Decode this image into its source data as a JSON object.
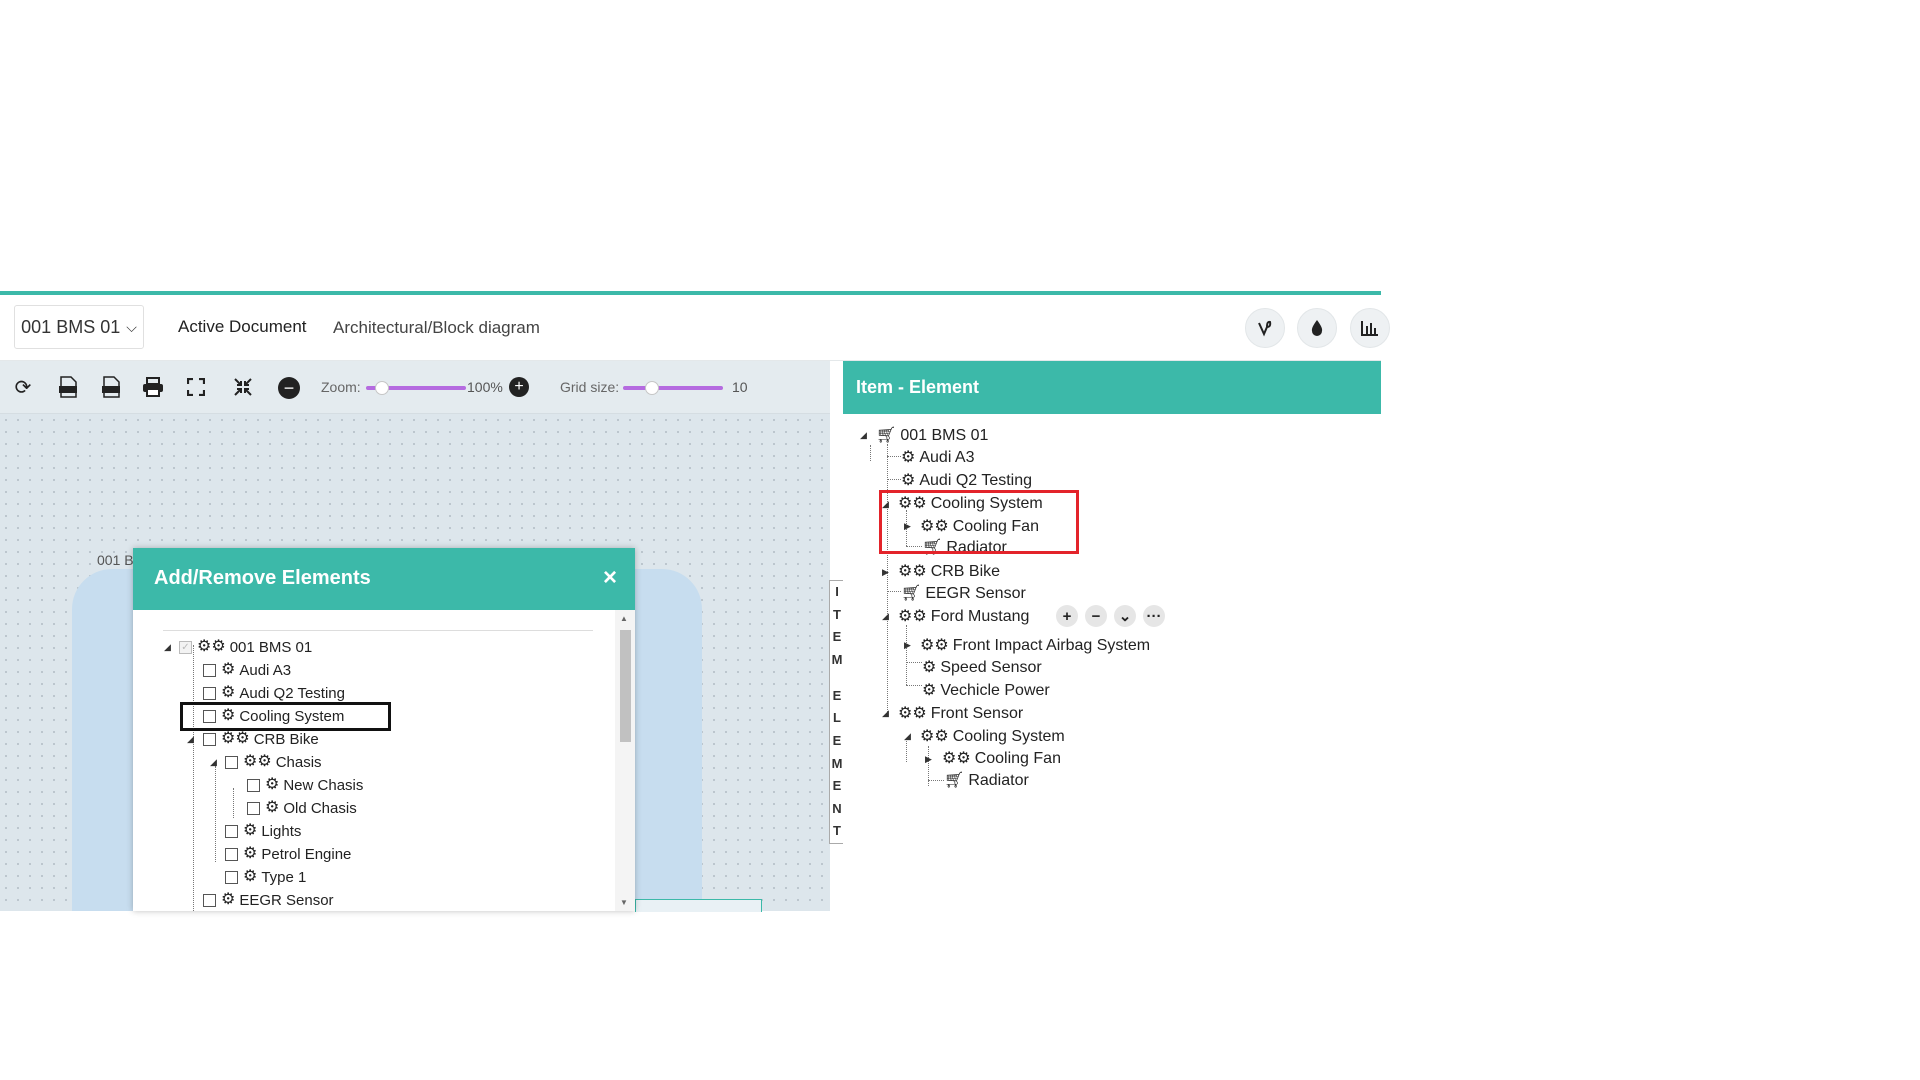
{
  "header": {
    "document_selector": "001 BMS 01",
    "active_document_label": "Active Document",
    "active_document_value": "Architectural/Block diagram",
    "icons": [
      "vine-icon",
      "drop-icon",
      "chart-icon"
    ]
  },
  "toolbar": {
    "svg_label": "SVG",
    "png_label": "PNG",
    "zoom_label": "Zoom:",
    "zoom_value": "100%",
    "grid_label": "Grid size:",
    "grid_value": "10",
    "zoom_fraction": 0.09,
    "grid_fraction": 0.22
  },
  "canvas": {
    "block_label": "001 B"
  },
  "side_tab": {
    "letters": [
      "I",
      "T",
      "E",
      "M",
      "",
      "E",
      "L",
      "E",
      "M",
      "E",
      "N",
      "T"
    ]
  },
  "item_panel": {
    "title": "Item - Element",
    "nodes": {
      "root": "001 BMS 01",
      "audi_a3": "Audi A3",
      "audi_q2": "Audi Q2 Testing",
      "cooling_system": "Cooling System",
      "cooling_fan": "Cooling Fan",
      "radiator": "Radiator",
      "crb_bike": "CRB Bike",
      "eegr_sensor": "EEGR Sensor",
      "ford_mustang": "Ford Mustang",
      "front_impact": "Front Impact Airbag System",
      "speed_sensor": "Speed Sensor",
      "vehicle_power": "Vechicle Power",
      "front_sensor": "Front Sensor",
      "fs_cooling_system": "Cooling System",
      "fs_cooling_fan": "Cooling Fan",
      "fs_radiator": "Radiator"
    },
    "actions": [
      "+",
      "−",
      "⌄",
      "···"
    ]
  },
  "modal": {
    "title": "Add/Remove Elements",
    "close": "×",
    "items": {
      "root": "001 BMS 01",
      "audi_a3": "Audi A3",
      "audi_q2": "Audi Q2 Testing",
      "cooling_system": "Cooling System",
      "crb_bike": "CRB Bike",
      "chasis": "Chasis",
      "new_chasis": "New Chasis",
      "old_chasis": "Old Chasis",
      "lights": "Lights",
      "petrol_engine": "Petrol Engine",
      "type1": "Type 1",
      "eegr_sensor": "EEGR Sensor"
    }
  },
  "colors": {
    "accent": "#3cb9a9",
    "slider": "#b56be0",
    "highlight_red": "#e3232a"
  }
}
